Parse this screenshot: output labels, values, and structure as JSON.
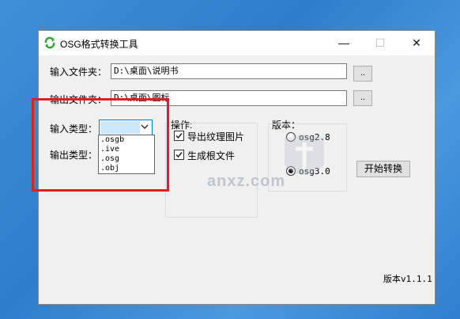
{
  "window": {
    "title": "OSG格式转换工具",
    "controls": {
      "minimize": "—",
      "maximize": "☐",
      "close": "✕"
    }
  },
  "input_folder": {
    "label": "输入文件夹：",
    "value": "D:\\桌面\\说明书",
    "browse_label": ".."
  },
  "output_folder": {
    "label": "输出文件夹：",
    "value": "D:\\桌面\\图标",
    "browse_label": ".."
  },
  "input_type": {
    "label": "输入类型：",
    "selected": "",
    "options": [
      ".osgb",
      ".ive",
      ".osg",
      ".obj"
    ]
  },
  "output_type": {
    "label": "输出类型："
  },
  "operations": {
    "label": "操作:",
    "export_texture": {
      "label": "导出纹理图片",
      "checked": true
    },
    "generate_root": {
      "label": "生成根文件",
      "checked": true
    }
  },
  "version_group": {
    "label": "版本：",
    "options": [
      {
        "label": "osg2.8",
        "checked": false
      },
      {
        "label": "osg3.0",
        "checked": true
      }
    ]
  },
  "start_button": {
    "label": "开始转换"
  },
  "version_info": "版本v1.1.1",
  "watermark": {
    "text": "anxz.com"
  }
}
